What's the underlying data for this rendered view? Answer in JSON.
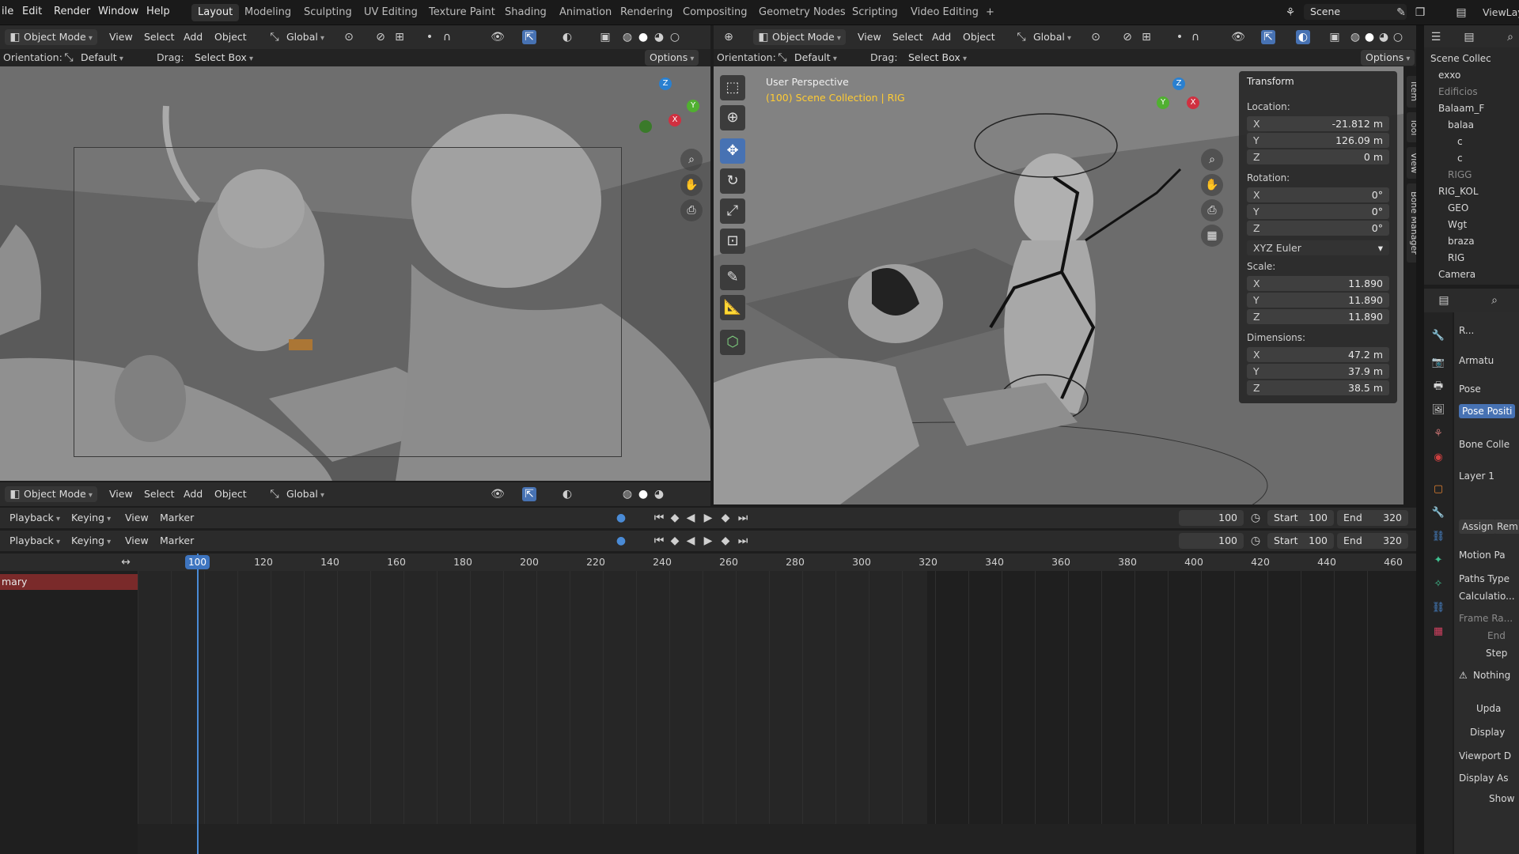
{
  "topbar": {
    "menus": [
      "ile",
      "Edit",
      "Render",
      "Window",
      "Help"
    ],
    "workspaces": [
      "Layout",
      "Modeling",
      "Sculpting",
      "UV Editing",
      "Texture Paint",
      "Shading",
      "Animation",
      "Rendering",
      "Compositing",
      "Geometry Nodes",
      "Scripting",
      "Video Editing"
    ],
    "add_tab": "+",
    "scene": "Scene",
    "viewlayer": "ViewLay"
  },
  "left_vp": {
    "mode": "Object Mode",
    "view": "View",
    "select": "Select",
    "add": "Add",
    "object": "Object",
    "orient_transform": "Global",
    "options": "Options",
    "orientation_label": "Orientation:",
    "orientation": "Default",
    "drag_label": "Drag:",
    "drag": "Select Box"
  },
  "right_vp": {
    "mode": "Object Mode",
    "view": "View",
    "select": "Select",
    "add": "Add",
    "object": "Object",
    "orient_transform": "Global",
    "options": "Options",
    "orientation_label": "Orientation:",
    "orientation": "Default",
    "drag_label": "Drag:",
    "drag": "Select Box",
    "perspective": "User Perspective",
    "collection": "(100) Scene Collection | RIG"
  },
  "npanel": {
    "title": "Transform",
    "location_label": "Location:",
    "location": [
      {
        "ax": "X",
        "val": "-21.812 m"
      },
      {
        "ax": "Y",
        "val": "126.09 m"
      },
      {
        "ax": "Z",
        "val": "0 m"
      }
    ],
    "rotation_label": "Rotation:",
    "rotation": [
      {
        "ax": "X",
        "val": "0°"
      },
      {
        "ax": "Y",
        "val": "0°"
      },
      {
        "ax": "Z",
        "val": "0°"
      }
    ],
    "rotation_mode": "XYZ Euler",
    "scale_label": "Scale:",
    "scale": [
      {
        "ax": "X",
        "val": "11.890"
      },
      {
        "ax": "Y",
        "val": "11.890"
      },
      {
        "ax": "Z",
        "val": "11.890"
      }
    ],
    "dimensions_label": "Dimensions:",
    "dimensions": [
      {
        "ax": "X",
        "val": "47.2 m"
      },
      {
        "ax": "Y",
        "val": "37.9 m"
      },
      {
        "ax": "Z",
        "val": "38.5 m"
      }
    ]
  },
  "side_tabs": [
    "Item",
    "Tool",
    "View",
    "Bone Manager"
  ],
  "bottom_vp": {
    "mode": "Object Mode",
    "view": "View",
    "select": "Select",
    "add": "Add",
    "object": "Object",
    "orient_transform": "Global"
  },
  "timeline": {
    "playback": "Playback",
    "keying": "Keying",
    "view": "View",
    "marker": "Marker",
    "current": "100",
    "start_label": "Start",
    "start": "100",
    "end_label": "End",
    "end": "320",
    "ticks": [
      "100",
      "120",
      "140",
      "160",
      "180",
      "200",
      "220",
      "240",
      "260",
      "280",
      "300",
      "320",
      "340",
      "360",
      "380",
      "400",
      "420",
      "440",
      "460"
    ],
    "channel": "mary"
  },
  "outliner": {
    "rows": [
      {
        "label": "Scene Collec",
        "color": "#d8d8d8"
      },
      {
        "label": "exxo",
        "color": "#d8d8d8"
      },
      {
        "label": "Edificios",
        "color": "#8a8a8a"
      },
      {
        "label": "Balaam_F",
        "color": "#d8d8d8"
      },
      {
        "label": "balaa",
        "color": "#d8d8d8"
      },
      {
        "label": "c",
        "color": "#d8d8d8"
      },
      {
        "label": "c",
        "color": "#d8d8d8"
      },
      {
        "label": "RIGG",
        "color": "#8a8a8a"
      },
      {
        "label": "RIG_KOL",
        "color": "#d8d8d8"
      },
      {
        "label": "GEO",
        "color": "#d8d8d8"
      },
      {
        "label": "Wgt",
        "color": "#d8d8d8"
      },
      {
        "label": "braza",
        "color": "#d8d8d8"
      },
      {
        "label": "RIG",
        "color": "#d8d8d8"
      },
      {
        "label": "Camera",
        "color": "#d8d8d8"
      }
    ]
  },
  "props": {
    "object": "R...",
    "armature": "Armatu",
    "pose": "Pose",
    "pose_position": "Pose Positi",
    "bone_coll": "Bone Colle",
    "layer": "Layer 1",
    "assign": "Assign",
    "remove": "Rem",
    "motion": "Motion Pa",
    "paths_type": "Paths Type",
    "calculation": "Calculatio...",
    "frame_range": "Frame Ra...",
    "end": "End",
    "step": "Step",
    "nothing": "Nothing",
    "update": "Upda",
    "display": "Display",
    "viewport": "Viewport D",
    "display_as": "Display As",
    "show": "Show"
  },
  "colors": {
    "accent": "#4772b3",
    "playhead": "#4a8bd6",
    "channel_red": "#7a2a2a",
    "collection_yellow": "#ffcc33"
  }
}
